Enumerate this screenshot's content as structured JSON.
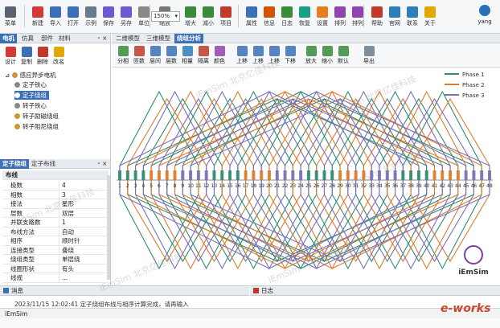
{
  "toolbar": {
    "buttons": [
      {
        "label": "菜单",
        "icon": "menu-icon",
        "color": "#5a6470"
      },
      {
        "label": "新建",
        "icon": "new-file-icon",
        "color": "#d23a3a"
      },
      {
        "label": "导入",
        "icon": "import-icon",
        "color": "#3b6fb6"
      },
      {
        "label": "打开",
        "icon": "open-folder-icon",
        "color": "#3b6fb6"
      },
      {
        "label": "示例",
        "icon": "example-icon",
        "color": "#6b7a8a"
      },
      {
        "label": "保存",
        "icon": "save-icon",
        "color": "#6a5acd"
      },
      {
        "label": "另存",
        "icon": "save-as-icon",
        "color": "#6a5acd"
      },
      {
        "label": "单位",
        "icon": "unit-icon",
        "color": "#888888"
      },
      {
        "label": "缩放",
        "icon": "zoom-icon",
        "color": "#777777"
      },
      {
        "label": "增大",
        "icon": "increase-icon",
        "color": "#3a8a3a"
      },
      {
        "label": "减小",
        "icon": "decrease-icon",
        "color": "#3a8a3a"
      },
      {
        "label": "项目",
        "icon": "project-icon",
        "color": "#c0392b"
      },
      {
        "label": "属性",
        "icon": "property-icon",
        "color": "#3b6fb6"
      },
      {
        "label": "信息",
        "icon": "info-icon",
        "color": "#d35400"
      },
      {
        "label": "日志",
        "icon": "log-icon",
        "color": "#3a8a3a"
      },
      {
        "label": "恢复",
        "icon": "restore-icon",
        "color": "#16a085"
      },
      {
        "label": "设置",
        "icon": "settings-icon",
        "color": "#e67e22"
      },
      {
        "label": "排列",
        "icon": "arrange-icon",
        "color": "#8e44ad"
      },
      {
        "label": "排列",
        "icon": "arrange-alt-icon",
        "color": "#8e44ad"
      },
      {
        "label": "帮助",
        "icon": "help-icon",
        "color": "#c0392b"
      },
      {
        "label": "官网",
        "icon": "website-icon",
        "color": "#2c7fb8"
      },
      {
        "label": "联系",
        "icon": "contact-icon",
        "color": "#2c7fb8"
      },
      {
        "label": "关于",
        "icon": "about-icon",
        "color": "#e0a800"
      }
    ],
    "zoom_value": "150%",
    "user_name": "yang"
  },
  "left_panel": {
    "tabs": [
      "电机",
      "仿真",
      "部件",
      "材料"
    ],
    "actions": [
      "设计",
      "复制",
      "删除",
      "改名"
    ],
    "tree": {
      "root": "感应异步电机",
      "children": [
        {
          "label": "定子铁心",
          "color": "#888888"
        },
        {
          "label": "定子绕组",
          "color": "#3b6fb6"
        },
        {
          "label": "转子铁心",
          "color": "#888888"
        },
        {
          "label": "转子励磁绕组",
          "color": "#c99a2e"
        },
        {
          "label": "转子阻尼绕组",
          "color": "#c99a2e"
        }
      ]
    },
    "prop_tabs": [
      "定子绕组",
      "定子布线"
    ],
    "prop_section": "布线",
    "properties": [
      {
        "key": "极数",
        "value": "4"
      },
      {
        "key": "相数",
        "value": "3"
      },
      {
        "key": "接法",
        "value": "星形"
      },
      {
        "key": "层数",
        "value": "双层"
      },
      {
        "key": "并联支路数",
        "value": "1"
      },
      {
        "key": "布线方法",
        "value": "自动"
      },
      {
        "key": "相序",
        "value": "顺时针"
      },
      {
        "key": "连接类型",
        "value": "叠绕"
      },
      {
        "key": "绕组类型",
        "value": "单层绕"
      },
      {
        "key": "线圈形状",
        "value": "有头"
      },
      {
        "key": "线规",
        "value": "..."
      }
    ]
  },
  "main": {
    "tabs": [
      "二维模型",
      "三维模型",
      "绕组分析"
    ],
    "tools": [
      "分相",
      "匝数",
      "层间",
      "层数",
      "相量",
      "隔离",
      "颜色",
      "上移",
      "上移",
      "上移",
      "下移",
      "放大",
      "缩小",
      "默认",
      "导出"
    ]
  },
  "chart_data": {
    "type": "line",
    "title": "",
    "xlabel": "",
    "ylabel": "",
    "legend_position": "top-right",
    "slots": 48,
    "series": [
      {
        "name": "Phase 1",
        "color": "#2e8b6f",
        "start_slot": 1
      },
      {
        "name": "Phase 2",
        "color": "#e07b2b",
        "start_slot": 5
      },
      {
        "name": "Phase 3",
        "color": "#7a6fb6",
        "start_slot": 9
      }
    ],
    "slot_labels": [
      "1",
      "2",
      "3",
      "4",
      "5",
      "6",
      "7",
      "8",
      "9",
      "10",
      "11",
      "12",
      "13",
      "14",
      "15",
      "16",
      "17",
      "18",
      "19",
      "20",
      "21",
      "22",
      "23",
      "24",
      "25",
      "26",
      "27",
      "28",
      "29",
      "30",
      "31",
      "32",
      "33",
      "34",
      "35",
      "36",
      "37",
      "38",
      "39",
      "40",
      "41",
      "42",
      "43",
      "44",
      "45",
      "46",
      "47",
      "48"
    ]
  },
  "watermarks": [
    "iEmSim 北京亿佳科技",
    "iEmSim 北京亿佳科技",
    "iEmSim 北京亿佳科技",
    "iEmSim 北京亿佳科技",
    "iEmSim 北京亿佳科技",
    "iEmSim 北京亿佳科技"
  ],
  "logo": {
    "text": "iEmSim"
  },
  "bottom": {
    "output_title": "消息",
    "log_title": "日志",
    "log_line": "2023/11/15 12:02:41  定子绕组布线与相序计算完成，请再输入",
    "status": "iEmSim",
    "brand": "e-works"
  }
}
